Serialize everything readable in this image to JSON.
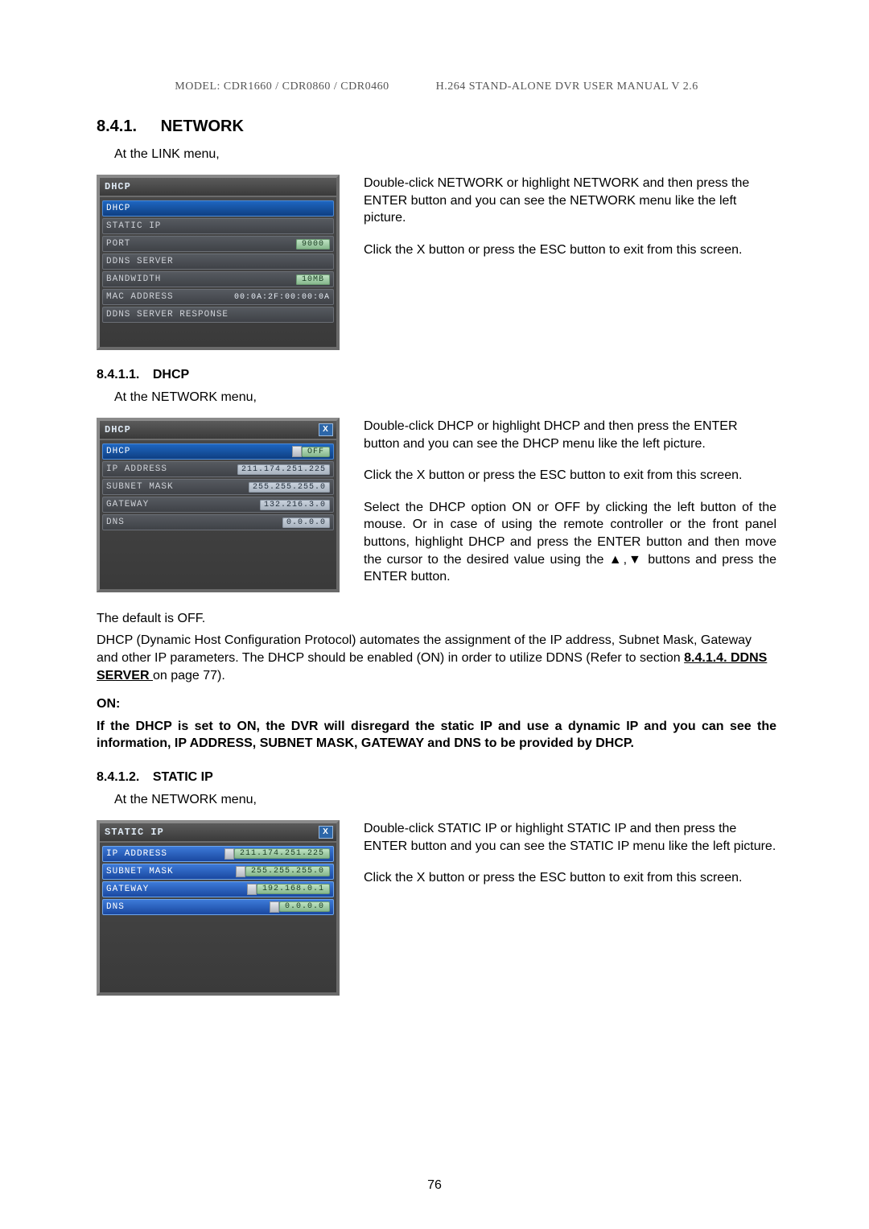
{
  "header": {
    "left": "MODEL: CDR1660 / CDR0860 / CDR0460",
    "right": "H.264 STAND-ALONE DVR USER MANUAL V 2.6"
  },
  "section": {
    "num": "8.4.1.",
    "title": "NETWORK",
    "intro": "At the LINK menu,"
  },
  "panel_network": {
    "title": "DHCP",
    "rows": [
      {
        "label": "DHCP",
        "kind": "sel"
      },
      {
        "label": "STATIC IP",
        "kind": "plain"
      },
      {
        "label": "PORT",
        "kind": "pill",
        "value": "9000"
      },
      {
        "label": "DDNS SERVER",
        "kind": "plain"
      },
      {
        "label": "BANDWIDTH",
        "kind": "pill",
        "value": "10MB"
      },
      {
        "label": "MAC ADDRESS",
        "kind": "text",
        "value": "00:0A:2F:00:00:0A"
      },
      {
        "label": "DDNS SERVER RESPONSE",
        "kind": "plain"
      }
    ]
  },
  "network_text": {
    "p1": "Double-click NETWORK or highlight NETWORK and then press the ENTER button and you can see the NETWORK menu like the left picture.",
    "p2": "Click the X button or press the ESC button to exit from this screen."
  },
  "dhcp": {
    "num": "8.4.1.1.",
    "title": "DHCP",
    "intro": "At the NETWORK menu,",
    "panel": {
      "title": "DHCP",
      "rows": [
        {
          "label": "DHCP",
          "kind": "toggle",
          "value": "OFF"
        },
        {
          "label": "IP ADDRESS",
          "kind": "box",
          "value": "211.174.251.225"
        },
        {
          "label": "SUBNET MASK",
          "kind": "box",
          "value": "255.255.255.0"
        },
        {
          "label": "GATEWAY",
          "kind": "box",
          "value": "132.216.3.0"
        },
        {
          "label": "DNS",
          "kind": "box",
          "value": "0.0.0.0"
        }
      ]
    },
    "p1": "Double-click DHCP or highlight DHCP and then press the ENTER button and you can see the DHCP menu like the left picture.",
    "p2": "Click the X button or press the ESC button to exit from this screen.",
    "p3": "Select the DHCP option ON or OFF by clicking the left button of the mouse. Or in case of using the remote controller or the front panel buttons, highlight DHCP and press the ENTER button and then move the cursor to the desired value using the ▲,▼ buttons and press  the ENTER  button.",
    "default": "The default is OFF.",
    "expl_a": "DHCP (Dynamic Host Configuration Protocol) automates the assignment of the IP address, Subnet Mask, Gateway and other IP parameters. The DHCP should be enabled (ON) in order to utilize DDNS (Refer to section ",
    "expl_link": "8.4.1.4. DDNS SERVER ",
    "expl_b": "on page 77).",
    "on_label": "ON:",
    "on_note": "If the DHCP is set to ON, the DVR will disregard the static IP and use a dynamic IP and you can see the information, IP ADDRESS, SUBNET MASK, GATEWAY and DNS to be provided by DHCP."
  },
  "staticip": {
    "num": "8.4.1.2.",
    "title": "STATIC IP",
    "intro": "At the NETWORK menu,",
    "panel": {
      "title": "STATIC IP",
      "rows": [
        {
          "label": "IP ADDRESS",
          "value": "211.174.251.225"
        },
        {
          "label": "SUBNET MASK",
          "value": "255.255.255.0"
        },
        {
          "label": "GATEWAY",
          "value": "192.168.0.1"
        },
        {
          "label": "DNS",
          "value": "0.0.0.0"
        }
      ]
    },
    "p1": "Double-click STATIC IP or highlight STATIC IP and then press the ENTER button and you can see the STATIC IP menu like the left picture.",
    "p2": "Click the X button or press the ESC button to exit from this screen."
  },
  "page_number": "76"
}
